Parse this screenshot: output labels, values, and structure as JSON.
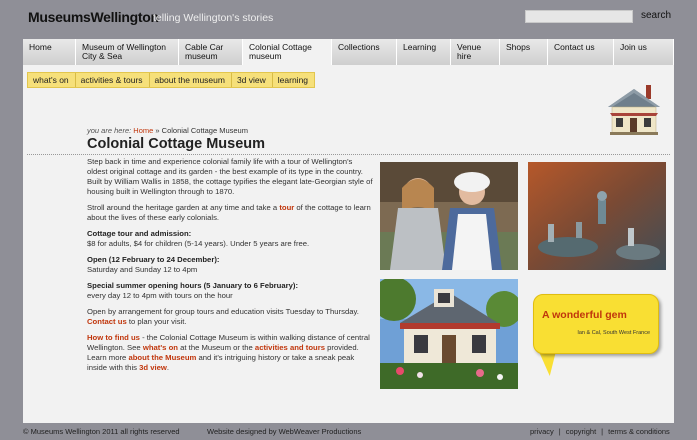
{
  "header": {
    "logo": "MuseumsWellington",
    "tagline": "telling Wellington's stories",
    "search_button": "search"
  },
  "nav": [
    {
      "label": "Home"
    },
    {
      "label": "Museum of Wellington City & Sea"
    },
    {
      "label": "Cable Car museum"
    },
    {
      "label": "Colonial Cottage museum"
    },
    {
      "label": "Collections"
    },
    {
      "label": "Learning"
    },
    {
      "label": "Venue hire"
    },
    {
      "label": "Shops"
    },
    {
      "label": "Contact us"
    },
    {
      "label": "Join us"
    }
  ],
  "subnav": [
    "what's on",
    "activities & tours",
    "about the museum",
    "3d view",
    "learning"
  ],
  "breadcrumb": {
    "prefix": "you are here:",
    "home": "Home",
    "sep": "»",
    "current": "Colonial Cottage Museum"
  },
  "page_title": "Colonial Cottage Museum",
  "content": {
    "p1": "Step back in time and experience colonial family life with a tour of Wellington's oldest original cottage and its garden - the best example of its type in the country. Built by William Wallis in 1858, the cottage typifies the elegant late-Georgian style of housing built in Wellington through to 1870.",
    "p2_a": "Stroll around the heritage garden at any time and take a ",
    "p2_link": "tour",
    "p2_b": " of the cottage to learn about the lives of these early colonials.",
    "admission_heading": "Cottage tour and admission:",
    "admission_text": "$8 for adults, $4 for children (5-14 years). Under 5 years are free.",
    "open_heading": "Open (12 February to 24 December):",
    "open_text": "Saturday and Sunday 12 to 4pm",
    "summer_heading": "Special summer opening hours (5 January to 6 February):",
    "summer_text": "every day 12 to 4pm with tours on the hour",
    "arrange_a": "Open by arrangement for group tours and education visits Tuesday to Thursday. ",
    "arrange_link": "Contact us",
    "arrange_b": " to plan your visit.",
    "find_link": "How to find us",
    "find_a": " - the Colonial Cottage Museum is within walking distance of central Wellington. See ",
    "find_link2": "what's on",
    "find_b": " at the Museum or the ",
    "find_link3": "activities and tours",
    "find_c": " provided. Learn more ",
    "find_link4": "about the Museum",
    "find_d": " and it's intriguing history or take a sneak peak inside with this ",
    "find_link5": "3d view",
    "find_e": "."
  },
  "quote": {
    "text": "A wonderful gem",
    "author": "Ian & Cal, South West France"
  },
  "footer": {
    "copyright": "© Museums Wellington 2011 all rights reserved",
    "designer": "Website designed by WebWeaver Productions",
    "links": [
      "privacy",
      "copyright",
      "terms & conditions"
    ],
    "separator": "|"
  },
  "colors": {
    "accent": "#c0360c",
    "subnav_bg": "#f3dc6e",
    "bubble": "#f9df33",
    "page_bg": "#8f8f97"
  }
}
